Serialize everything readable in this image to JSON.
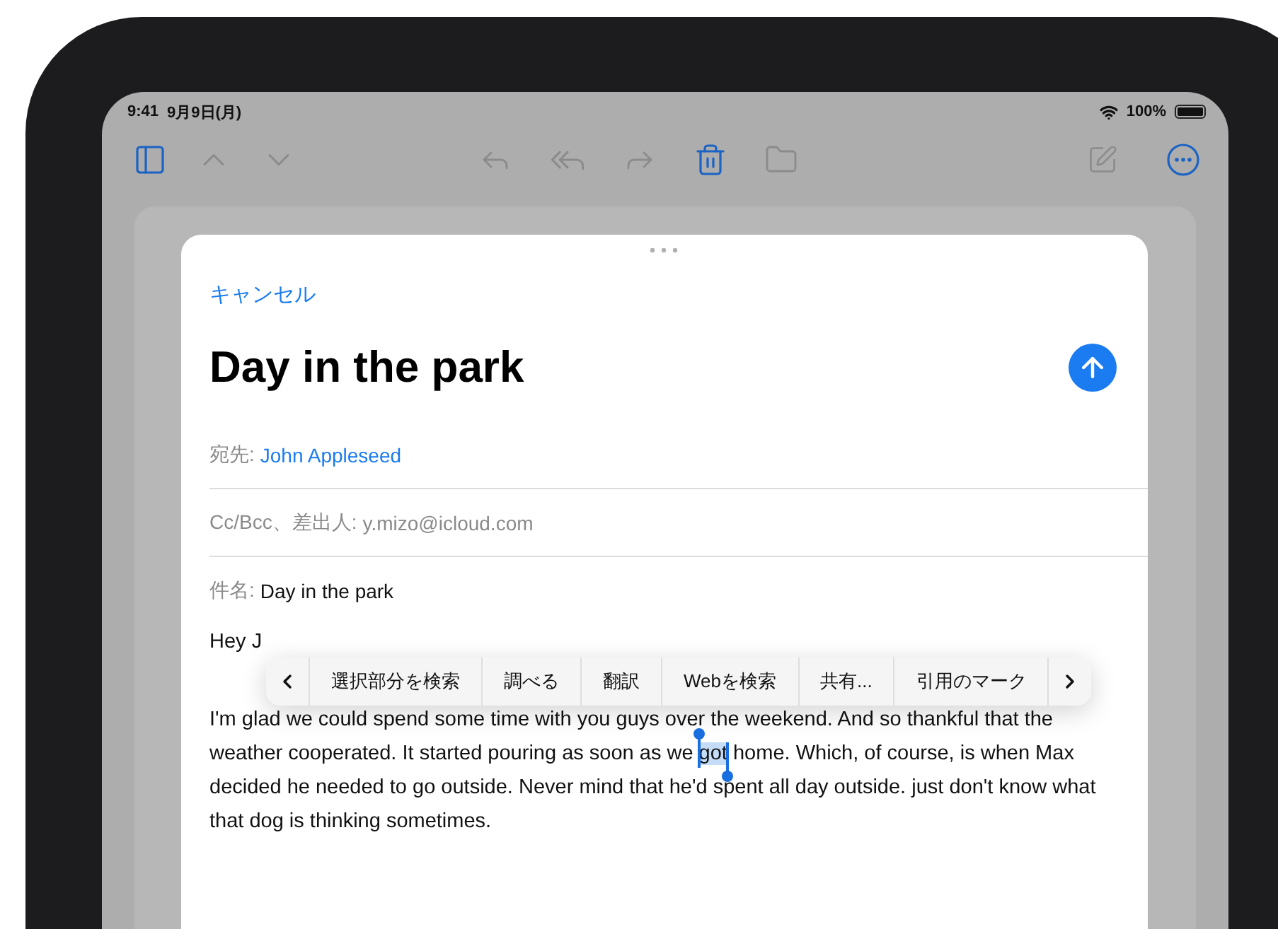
{
  "status_bar": {
    "time": "9:41",
    "date": "9月9日(月)",
    "battery": "100%"
  },
  "sheet": {
    "cancel": "キャンセル",
    "title": "Day in the park",
    "fields": [
      {
        "kind": "recipient",
        "label": "宛先:",
        "value": "John Appleseed"
      },
      {
        "kind": "meta",
        "label": "Cc/Bcc、差出人:",
        "value": "y.mizo@icloud.com"
      },
      {
        "kind": "subject",
        "label": "件名:",
        "value": "Day in the park"
      }
    ],
    "body": {
      "greeting": "Hey J",
      "before": "I'm glad we could spend some time with you guys over the weekend. And so thankful that the weather cooperated. It started pouring as soon as we ",
      "selected": "got",
      "after": " home. Which, of course, is when Max decided he needed to go outside. Never mind that he'd spent all day outside. just don't know what that dog is thinking sometimes."
    }
  },
  "edit_menu": {
    "items": [
      "選択部分を検索",
      "調べる",
      "翻訳",
      "Webを検索",
      "共有...",
      "引用のマーク"
    ]
  }
}
